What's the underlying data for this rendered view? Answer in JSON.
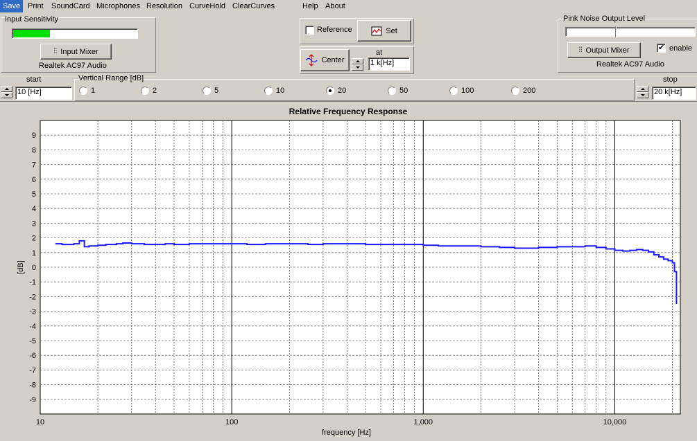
{
  "menu": [
    "Save",
    "Print",
    "SoundCard",
    "Microphones",
    "Resolution",
    "CurveHold",
    "ClearCurves",
    "Help",
    "About"
  ],
  "input_sensitivity": {
    "title": "Input Sensitivity",
    "level": 0.3,
    "level_color": "#00e000",
    "mixer_label": "Input Mixer",
    "device": "Realtek AC97 Audio"
  },
  "reference": {
    "label": "Reference",
    "checked": false,
    "set_label": "Set"
  },
  "center": {
    "label": "Center",
    "at_label": "at",
    "value": "1 k[Hz]"
  },
  "pink_noise": {
    "title": "Pink Noise Output Level",
    "level": 0.38,
    "mixer_label": "Output Mixer",
    "enable_label": "enable",
    "enabled": true,
    "device": "Realtek AC97 Audio"
  },
  "start": {
    "label": "start",
    "value": "10 [Hz]"
  },
  "stop": {
    "label": "stop",
    "value": "20 k[Hz]"
  },
  "vertical_range": {
    "title": "Vertical Range [dB]",
    "options": [
      "1",
      "2",
      "5",
      "10",
      "20",
      "50",
      "100",
      "200"
    ],
    "selected": "20"
  },
  "chart_data": {
    "type": "line",
    "title": "Relative Frequency Response",
    "xlabel": "frequency [Hz]",
    "ylabel": "[dB]",
    "xscale": "log",
    "xlim": [
      10,
      22000
    ],
    "ylim": [
      -10,
      10
    ],
    "xticks": [
      10,
      100,
      1000,
      10000
    ],
    "xtick_labels": [
      "10",
      "100",
      "1,000",
      "10,000"
    ],
    "yticks": [
      9,
      8,
      7,
      6,
      5,
      4,
      3,
      2,
      1,
      0,
      -1,
      -2,
      -3,
      -4,
      -5,
      -6,
      -7,
      -8,
      -9
    ],
    "grid": true,
    "line_color": "#1a1aff",
    "series": [
      {
        "x": [
          12,
          13,
          14,
          15,
          16,
          17,
          18,
          20,
          22,
          25,
          27,
          30,
          35,
          40,
          45,
          50,
          55,
          60,
          70,
          80,
          90,
          100,
          120,
          150,
          200,
          250,
          300,
          400,
          500,
          600,
          800,
          1000,
          1200,
          1500,
          2000,
          2500,
          3000,
          4000,
          5000,
          6000,
          7000,
          8000,
          9000,
          10000,
          11000,
          12000,
          13000,
          14000,
          15000,
          16000,
          17000,
          18000,
          19000,
          20000,
          20500,
          21000
        ],
        "y": [
          1.6,
          1.55,
          1.55,
          1.6,
          1.8,
          1.4,
          1.45,
          1.5,
          1.55,
          1.6,
          1.65,
          1.6,
          1.55,
          1.55,
          1.6,
          1.55,
          1.55,
          1.6,
          1.6,
          1.6,
          1.6,
          1.6,
          1.55,
          1.6,
          1.6,
          1.55,
          1.6,
          1.6,
          1.55,
          1.55,
          1.55,
          1.5,
          1.45,
          1.45,
          1.4,
          1.35,
          1.3,
          1.35,
          1.4,
          1.4,
          1.45,
          1.35,
          1.25,
          1.15,
          1.1,
          1.15,
          1.2,
          1.15,
          1.05,
          0.85,
          0.7,
          0.55,
          0.45,
          0.3,
          -0.3,
          -2.5
        ]
      }
    ]
  }
}
